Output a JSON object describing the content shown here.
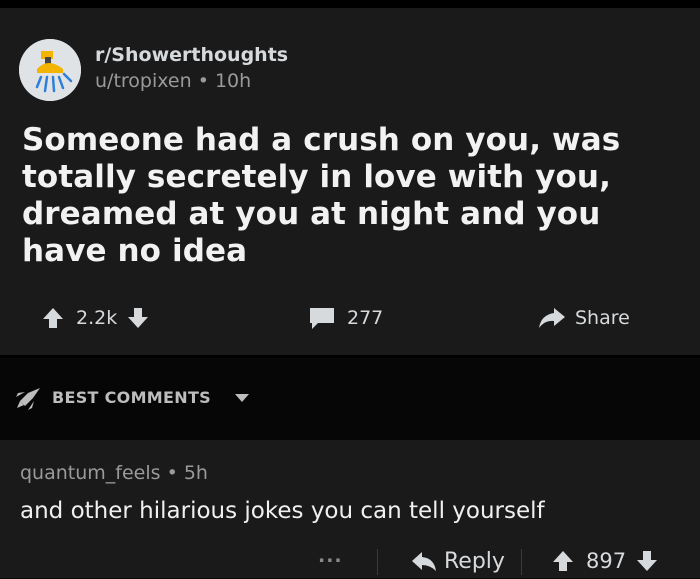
{
  "post": {
    "subreddit": "r/Showerthoughts",
    "author": "u/tropixen",
    "age": "10h",
    "title": "Someone had a crush on you, was totally secretely in love with you, dreamed at you at night and you have no idea",
    "upvotes": "2.2k",
    "comments": "277",
    "share_label": "Share",
    "icons": {
      "subreddit": "shower-head-icon",
      "upvote": "arrow-up-icon",
      "downvote": "arrow-down-icon",
      "comments": "speech-bubble-icon",
      "share": "share-arrow-icon"
    }
  },
  "sort": {
    "label": "BEST COMMENTS",
    "icons": {
      "sort": "rocket-icon",
      "dropdown": "caret-down-icon"
    }
  },
  "comment": {
    "author": "quantum_feels",
    "age": "5h",
    "text": "and other hilarious jokes you can tell yourself",
    "more_label": "...",
    "reply_label": "Reply",
    "score": "897",
    "icons": {
      "reply": "reply-arrow-icon",
      "upvote": "arrow-up-icon",
      "downvote": "arrow-down-icon"
    }
  },
  "colors": {
    "background": "#0b0b0b",
    "card": "#1a1a1b",
    "text": "#f2f2f2",
    "muted": "#9a9a9a"
  }
}
